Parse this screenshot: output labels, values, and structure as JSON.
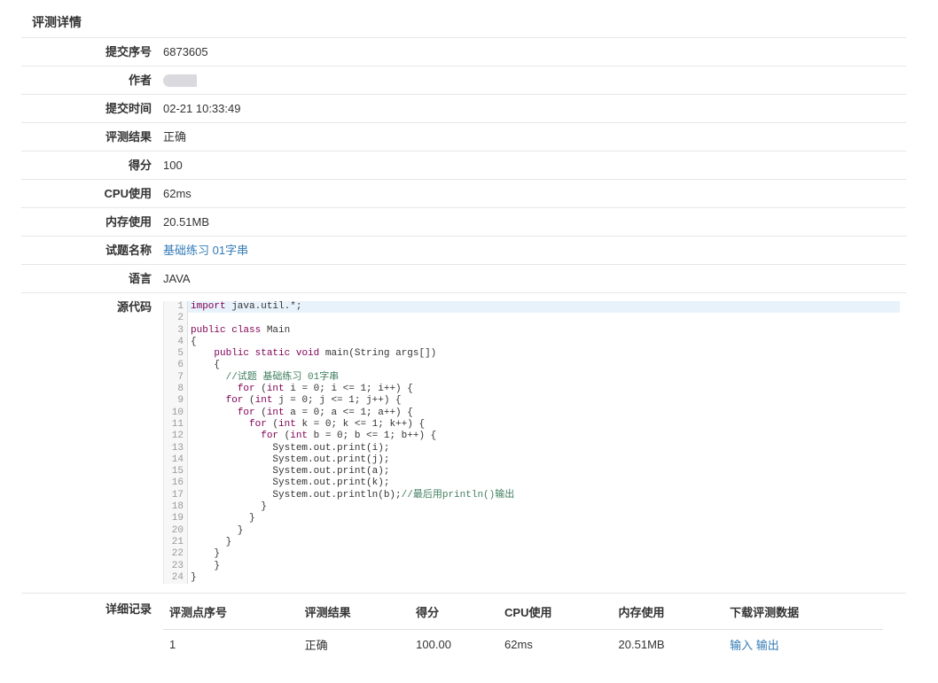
{
  "panel": {
    "title": "评测详情"
  },
  "info": [
    {
      "label": "提交序号",
      "value": "6873605"
    },
    {
      "label": "作者",
      "value": ""
    },
    {
      "label": "提交时间",
      "value": "02-21 10:33:49"
    },
    {
      "label": "评测结果",
      "value": "正确"
    },
    {
      "label": "得分",
      "value": "100"
    },
    {
      "label": "CPU使用",
      "value": "62ms"
    },
    {
      "label": "内存使用",
      "value": "20.51MB"
    },
    {
      "label": "试题名称",
      "value": "基础练习 01字串"
    },
    {
      "label": "语言",
      "value": "JAVA"
    }
  ],
  "source": {
    "label": "源代码",
    "lines": [
      "import java.util.*;",
      "",
      "public class Main",
      "{",
      "    public static void main(String args[])",
      "    {",
      "      //试题 基础练习 01字串",
      "        for (int i = 0; i <= 1; i++) {",
      "      for (int j = 0; j <= 1; j++) {",
      "        for (int a = 0; a <= 1; a++) {",
      "          for (int k = 0; k <= 1; k++) {",
      "            for (int b = 0; b <= 1; b++) {",
      "              System.out.print(i);",
      "              System.out.print(j);",
      "              System.out.print(a);",
      "              System.out.print(k);",
      "              System.out.println(b);//最后用println()输出",
      "            }",
      "          }",
      "        }",
      "      }",
      "    }",
      "    }",
      "}"
    ]
  },
  "detail": {
    "label": "详细记录",
    "headers": [
      "评测点序号",
      "评测结果",
      "得分",
      "CPU使用",
      "内存使用",
      "下载评测数据"
    ],
    "rows": [
      {
        "index": "1",
        "result": "正确",
        "score": "100.00",
        "cpu": "62ms",
        "memory": "20.51MB",
        "input": "输入",
        "output": "输出"
      }
    ]
  }
}
